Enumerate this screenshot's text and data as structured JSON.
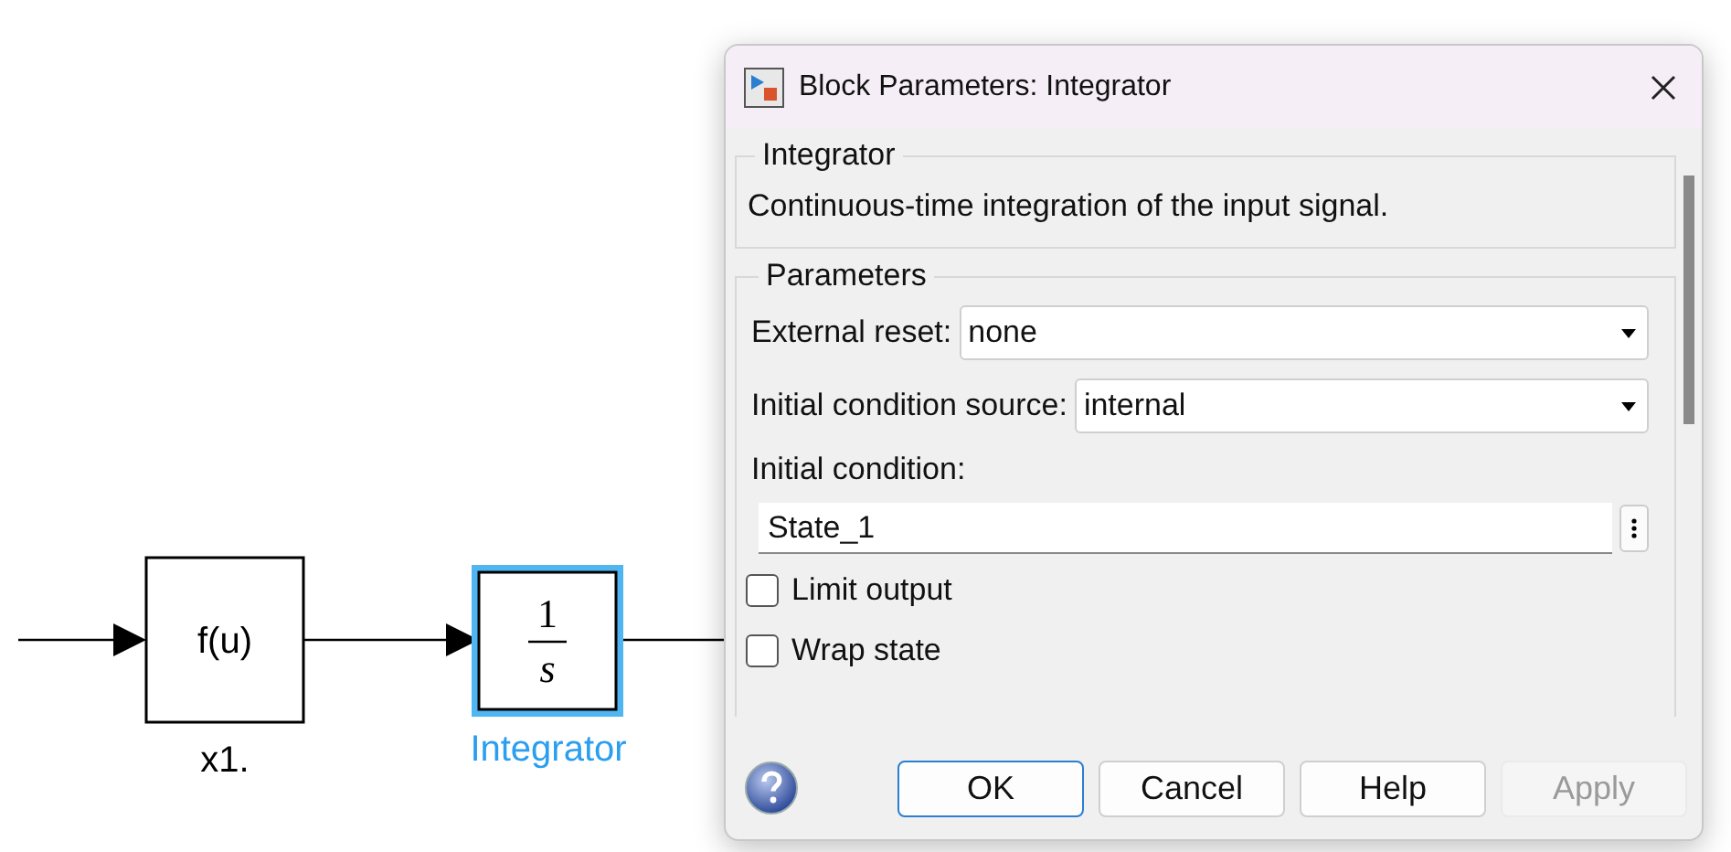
{
  "diagram": {
    "blocks": [
      {
        "kind": "function",
        "text": "f(u)",
        "label": "x1.",
        "selected": false
      },
      {
        "kind": "integrator",
        "numerator": "1",
        "denominator": "s",
        "label": "Integrator",
        "selected": true
      }
    ]
  },
  "dialog": {
    "title": "Block Parameters: Integrator",
    "description_group": {
      "title": "Integrator",
      "text": "Continuous-time integration of the input signal."
    },
    "parameters": {
      "title": "Parameters",
      "fields": [
        {
          "kind": "dropdown",
          "label": "External reset:",
          "value": "none"
        },
        {
          "kind": "dropdown",
          "label": "Initial condition source:",
          "value": "internal"
        },
        {
          "kind": "text",
          "label": "Initial condition:",
          "value": "State_1"
        },
        {
          "kind": "checkbox",
          "label": "Limit output",
          "checked": false
        },
        {
          "kind": "checkbox",
          "label": "Wrap state",
          "checked": false
        }
      ]
    },
    "buttons": [
      {
        "label": "OK",
        "default": true,
        "disabled": false
      },
      {
        "label": "Cancel",
        "default": false,
        "disabled": false
      },
      {
        "label": "Help",
        "default": false,
        "disabled": false
      },
      {
        "label": "Apply",
        "default": false,
        "disabled": true
      }
    ]
  }
}
